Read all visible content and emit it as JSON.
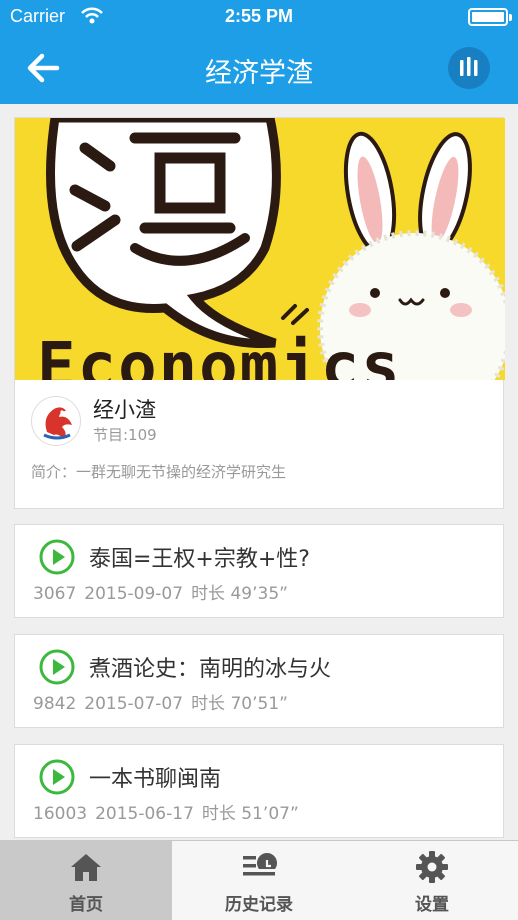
{
  "status_bar": {
    "carrier": "Carrier",
    "time": "2:55 PM"
  },
  "nav": {
    "title": "经济学渣"
  },
  "podcast": {
    "banner_text": "Economics",
    "name": "经小渣",
    "episodes_count": "节目:109",
    "description": "简介：一群无聊无节操的经济学研究生"
  },
  "episodes": [
    {
      "title": "泰国=王权+宗教+性?",
      "plays": "3067",
      "date": "2015-09-07",
      "duration": "时长 49’35”"
    },
    {
      "title": "煮酒论史：南明的冰与火",
      "plays": "9842",
      "date": "2015-07-07",
      "duration": "时长 70’51”"
    },
    {
      "title": "一本书聊闽南",
      "plays": "16003",
      "date": "2015-06-17",
      "duration": "时长 51’07”"
    }
  ],
  "tabs": [
    {
      "label": "首页",
      "icon": "home-icon"
    },
    {
      "label": "历史记录",
      "icon": "history-icon"
    },
    {
      "label": "设置",
      "icon": "gear-icon"
    }
  ],
  "colors": {
    "brand": "#1e9ee6",
    "play": "#3cb83c",
    "banner": "#f6d92b"
  }
}
